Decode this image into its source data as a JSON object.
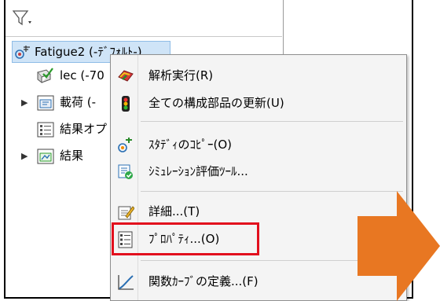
{
  "tree": {
    "root_label": "Fatigue2 (-ﾃﾞﾌｫﾙﾄ-)",
    "items": [
      {
        "label": "lec (-70"
      },
      {
        "label": "載荷 (-"
      },
      {
        "label": "結果オプ"
      },
      {
        "label": "結果"
      }
    ]
  },
  "context_menu": {
    "items": [
      {
        "label": "解析実行(R)",
        "icon": "run-analysis-icon"
      },
      {
        "label": "全ての構成部品の更新(U)",
        "icon": "traffic-light-icon"
      },
      {
        "label": "ｽﾀﾃﾞｨのｺﾋﾟｰ(O)",
        "icon": "copy-study-icon"
      },
      {
        "label": "ｼﾐｭﾚｰｼｮﾝ評価ﾂｰﾙ...",
        "icon": "simulation-evaluator-icon"
      },
      {
        "label": "詳細...(T)",
        "icon": "details-icon"
      },
      {
        "label": "ﾌﾟﾛﾊﾟﾃｨ...(O)",
        "icon": "properties-icon"
      },
      {
        "label": "関数ｶｰﾌﾞの定義...(F)",
        "icon": "function-curve-icon"
      }
    ]
  },
  "colors": {
    "highlight_box": "#e20f1d",
    "arrow": "#e87722",
    "selection": "#cfe4f7"
  }
}
